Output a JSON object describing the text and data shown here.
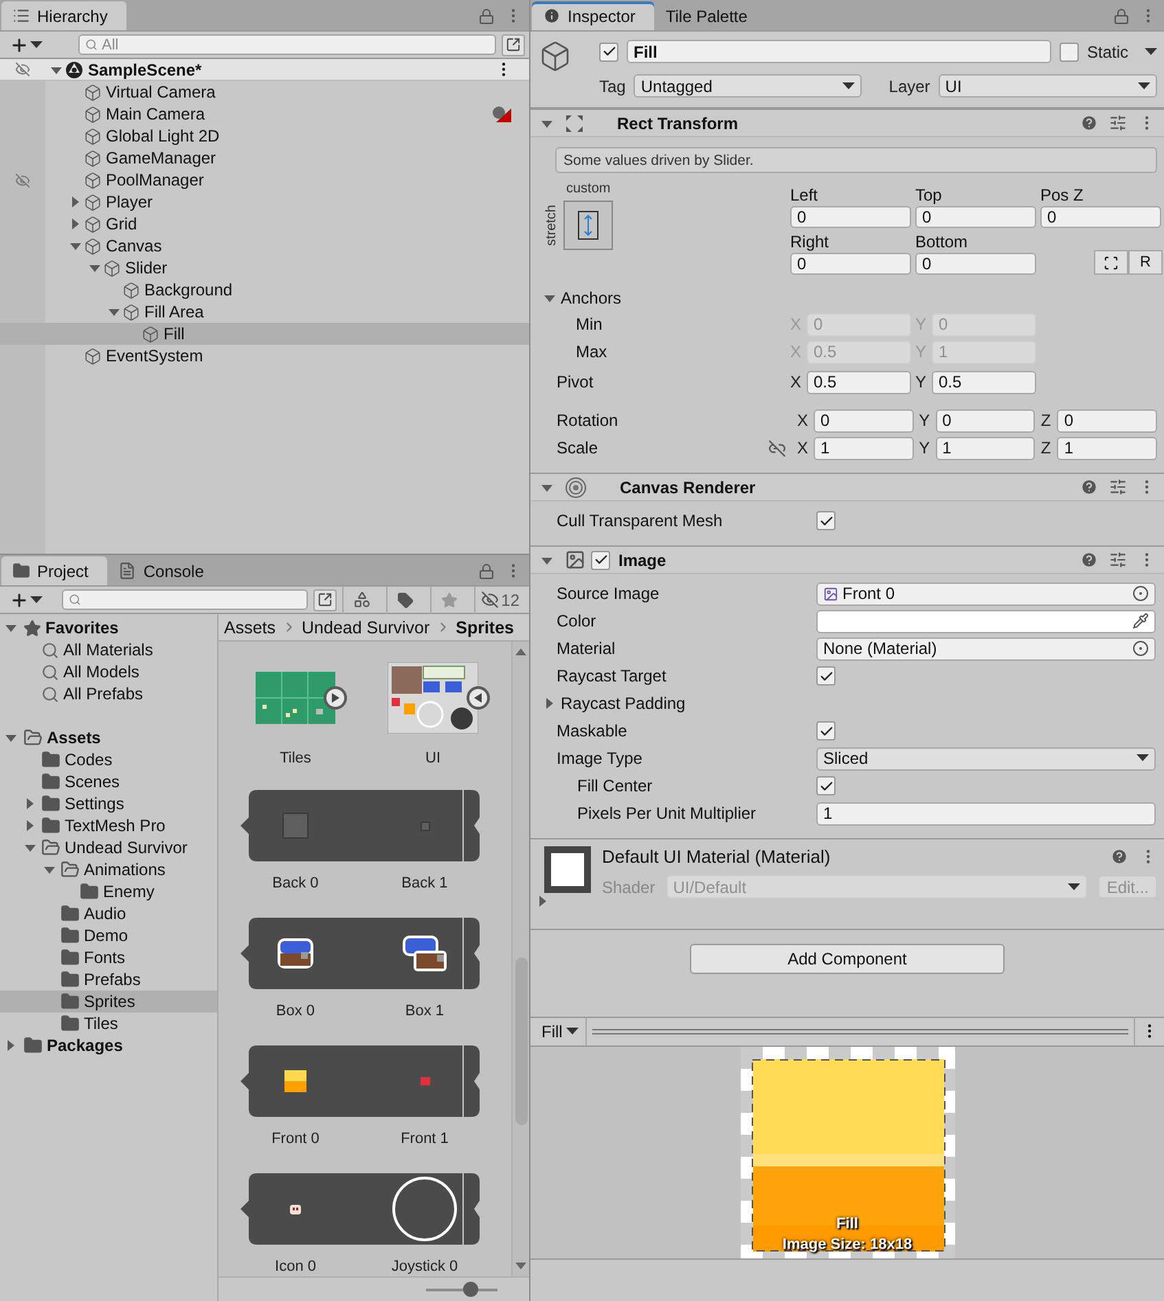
{
  "hierarchy": {
    "title": "Hierarchy",
    "search": {
      "placeholder": "All"
    },
    "scene": {
      "name": "SampleScene*",
      "expanded": true,
      "hidden": true,
      "children": [
        {
          "name": "Virtual Camera",
          "selected": false,
          "hidden": false,
          "gizmo": false
        },
        {
          "name": "Main Camera",
          "selected": false,
          "hidden": false,
          "gizmo": true
        },
        {
          "name": "Global Light 2D",
          "selected": false,
          "hidden": false,
          "gizmo": false
        },
        {
          "name": "GameManager",
          "selected": false,
          "hidden": false,
          "gizmo": false
        },
        {
          "name": "PoolManager",
          "selected": false,
          "hidden": true,
          "gizmo": false
        },
        {
          "name": "Player",
          "selected": false,
          "hidden": false,
          "gizmo": false,
          "expanded": false
        },
        {
          "name": "Grid",
          "selected": false,
          "hidden": false,
          "gizmo": false,
          "expanded": false
        },
        {
          "name": "Canvas",
          "selected": false,
          "hidden": false,
          "gizmo": false,
          "expanded": true,
          "children": [
            {
              "name": "Slider",
              "selected": false,
              "hidden": false,
              "gizmo": false,
              "expanded": true,
              "children": [
                {
                  "name": "Background",
                  "selected": false,
                  "hidden": false,
                  "gizmo": false
                },
                {
                  "name": "Fill Area",
                  "selected": false,
                  "hidden": false,
                  "gizmo": false,
                  "expanded": true,
                  "children": [
                    {
                      "name": "Fill",
                      "selected": true,
                      "hidden": false,
                      "gizmo": false
                    }
                  ]
                }
              ]
            }
          ]
        },
        {
          "name": "EventSystem",
          "selected": false,
          "hidden": false,
          "gizmo": false
        }
      ]
    }
  },
  "project": {
    "tabs": [
      {
        "label": "Project",
        "selected": true
      },
      {
        "label": "Console",
        "selected": false
      }
    ],
    "hidden_count": "12",
    "tree": [
      {
        "label": "Favorites",
        "kind": "favorites",
        "selected": false,
        "expanded": true,
        "children": [
          {
            "label": "All Materials",
            "kind": "search",
            "selected": false
          },
          {
            "label": "All Models",
            "kind": "search",
            "selected": false
          },
          {
            "label": "All Prefabs",
            "kind": "search",
            "selected": false
          }
        ]
      },
      {
        "label": "Assets",
        "kind": "folder",
        "selected": false,
        "expanded": true,
        "children": [
          {
            "label": "Codes",
            "kind": "folder",
            "selected": false
          },
          {
            "label": "Scenes",
            "kind": "folder",
            "selected": false
          },
          {
            "label": "Settings",
            "kind": "folder",
            "selected": false,
            "expanded": false
          },
          {
            "label": "TextMesh Pro",
            "kind": "folder",
            "selected": false,
            "expanded": false
          },
          {
            "label": "Undead Survivor",
            "kind": "folder",
            "selected": false,
            "expanded": true,
            "children": [
              {
                "label": "Animations",
                "kind": "folder",
                "selected": false,
                "expanded": true,
                "children": [
                  {
                    "label": "Enemy",
                    "kind": "folder",
                    "selected": false
                  }
                ]
              },
              {
                "label": "Audio",
                "kind": "folder",
                "selected": false
              },
              {
                "label": "Demo",
                "kind": "folder",
                "selected": false
              },
              {
                "label": "Fonts",
                "kind": "folder",
                "selected": false
              },
              {
                "label": "Prefabs",
                "kind": "folder",
                "selected": false
              },
              {
                "label": "Sprites",
                "kind": "folder",
                "selected": true
              },
              {
                "label": "Tiles",
                "kind": "folder",
                "selected": false
              }
            ]
          }
        ]
      },
      {
        "label": "Packages",
        "kind": "folder",
        "selected": false,
        "expanded": false
      }
    ],
    "breadcrumb": [
      "Assets",
      "Undead Survivor",
      "Sprites"
    ],
    "assets": [
      {
        "kind": "sheets",
        "items": [
          {
            "label": "Tiles",
            "expanded": false
          },
          {
            "label": "UI",
            "expanded": true
          }
        ]
      },
      {
        "kind": "strip",
        "items": [
          {
            "label": "Back 0"
          },
          {
            "label": "Back 1"
          }
        ]
      },
      {
        "kind": "strip",
        "items": [
          {
            "label": "Box 0"
          },
          {
            "label": "Box 1"
          }
        ]
      },
      {
        "kind": "strip",
        "items": [
          {
            "label": "Front 0"
          },
          {
            "label": "Front 1"
          }
        ]
      },
      {
        "kind": "strip",
        "items": [
          {
            "label": "Icon 0"
          },
          {
            "label": "Joystick 0"
          }
        ]
      }
    ],
    "thumbnail_size": {
      "level": 0.62
    }
  },
  "inspector": {
    "tabs": [
      {
        "label": "Inspector",
        "selected": true
      },
      {
        "label": "Tile Palette",
        "selected": false
      }
    ],
    "object": {
      "active": true,
      "name": "Fill",
      "static": false,
      "static_label": "Static",
      "tag_label": "Tag",
      "tag": "Untagged",
      "layer_label": "Layer",
      "layer": "UI"
    },
    "components": [
      {
        "kind": "rect_transform",
        "title": "Rect Transform",
        "expanded": true,
        "note": "Some values driven by Slider.",
        "preset": {
          "horizontal": "custom",
          "vertical": "stretch"
        },
        "offsets": [
          {
            "label": "Left",
            "value": "0"
          },
          {
            "label": "Top",
            "value": "0"
          },
          {
            "label": "Pos Z",
            "value": "0"
          },
          {
            "label": "Right",
            "value": "0"
          },
          {
            "label": "Bottom",
            "value": "0"
          }
        ],
        "reset_label": "R",
        "anchors": {
          "label": "Anchors",
          "expanded": true,
          "children": [
            {
              "label": "Min",
              "disabled": true,
              "axes": [
                {
                  "axis": "X",
                  "value": "0"
                },
                {
                  "axis": "Y",
                  "value": "0"
                }
              ]
            },
            {
              "label": "Max",
              "disabled": true,
              "axes": [
                {
                  "axis": "X",
                  "value": "0.5"
                },
                {
                  "axis": "Y",
                  "value": "1"
                }
              ]
            }
          ]
        },
        "vectors": [
          {
            "label": "Pivot",
            "disabled": false,
            "axes": [
              {
                "axis": "X",
                "value": "0.5"
              },
              {
                "axis": "Y",
                "value": "0.5"
              }
            ]
          },
          {
            "label": "Rotation",
            "disabled": false,
            "axes": [
              {
                "axis": "X",
                "value": "0"
              },
              {
                "axis": "Y",
                "value": "0"
              },
              {
                "axis": "Z",
                "value": "0"
              }
            ]
          },
          {
            "label": "Scale",
            "disabled": false,
            "constrained": false,
            "axes": [
              {
                "axis": "X",
                "value": "1"
              },
              {
                "axis": "Y",
                "value": "1"
              },
              {
                "axis": "Z",
                "value": "1"
              }
            ]
          }
        ]
      },
      {
        "kind": "canvas_renderer",
        "title": "Canvas Renderer",
        "expanded": true,
        "fields": [
          {
            "kind": "check",
            "label": "Cull Transparent Mesh",
            "checked": true
          }
        ]
      },
      {
        "kind": "image",
        "title": "Image",
        "expanded": true,
        "enabled": true,
        "fields": [
          {
            "kind": "sprite",
            "label": "Source Image",
            "value": "Front 0"
          },
          {
            "kind": "color",
            "label": "Color",
            "color": "#ffffff"
          },
          {
            "kind": "object",
            "label": "Material",
            "value": "None (Material)"
          },
          {
            "kind": "check",
            "label": "Raycast Target",
            "checked": true
          },
          {
            "kind": "foldout",
            "label": "Raycast Padding",
            "expanded": false
          },
          {
            "kind": "check",
            "label": "Maskable",
            "checked": true
          },
          {
            "kind": "dropdown",
            "label": "Image Type",
            "value": "Sliced",
            "children": [
              {
                "kind": "check",
                "label": "Fill Center",
                "checked": true
              },
              {
                "kind": "text",
                "label": "Pixels Per Unit Multiplier",
                "value": "1"
              }
            ]
          }
        ]
      }
    ],
    "material": {
      "title": "Default UI Material (Material)",
      "expanded": false,
      "shader_label": "Shader",
      "shader": "UI/Default",
      "edit_label": "Edit...",
      "disabled": true
    },
    "add_component": "Add Component",
    "preview": {
      "selector": "Fill",
      "caption": "Fill",
      "size": "Image Size: 18x18"
    }
  }
}
